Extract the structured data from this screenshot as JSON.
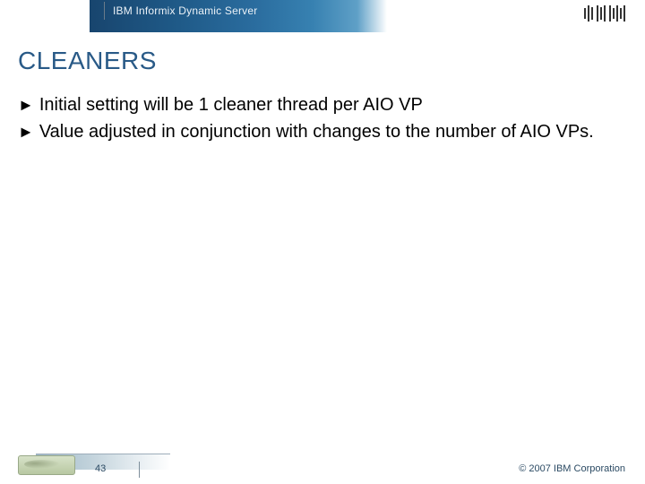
{
  "header": {
    "product": "IBM Informix Dynamic Server",
    "logo_alt": "IBM"
  },
  "title": "CLEANERS",
  "bullets": [
    "Initial setting will be 1 cleaner thread per AIO VP",
    "Value adjusted in conjunction with changes to the number of AIO VPs."
  ],
  "footer": {
    "page_number": "43",
    "copyright": "© 2007 IBM Corporation"
  }
}
